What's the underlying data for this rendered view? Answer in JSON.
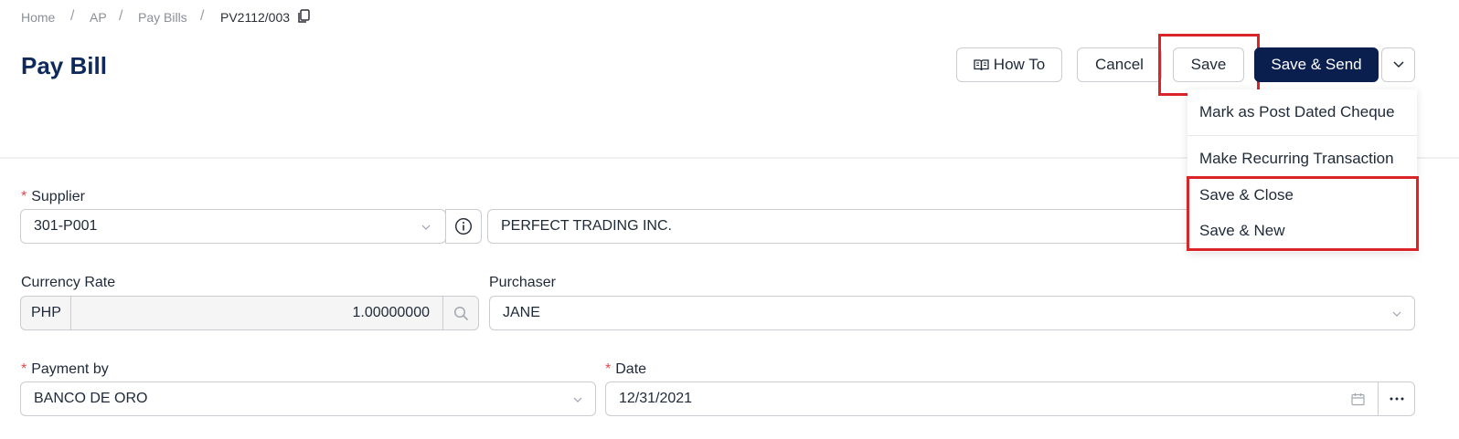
{
  "breadcrumb": {
    "items": [
      "Home",
      "AP",
      "Pay Bills"
    ],
    "separator": "/",
    "current": "PV2112/003"
  },
  "header": {
    "title": "Pay Bill",
    "how_to_label": "How To",
    "cancel_label": "Cancel",
    "save_label": "Save",
    "save_send_label": "Save & Send"
  },
  "menu": {
    "items": [
      "Mark as Post Dated Cheque",
      "Make Recurring Transaction",
      "Save & Close",
      "Save & New"
    ]
  },
  "form": {
    "supplier": {
      "label": "Supplier",
      "code": "301-P001",
      "name": "PERFECT TRADING INC."
    },
    "currency_rate": {
      "label": "Currency Rate",
      "currency": "PHP",
      "value": "1.00000000"
    },
    "purchaser": {
      "label": "Purchaser",
      "value": "JANE"
    },
    "payment_by": {
      "label": "Payment by",
      "value": "BANCO DE ORO"
    },
    "date": {
      "label": "Date",
      "value": "12/31/2021"
    }
  },
  "colors": {
    "title": "#0e2a5c",
    "primary_button": "#0b1f4f",
    "highlight": "#d9252a",
    "required": "#e5484d"
  }
}
